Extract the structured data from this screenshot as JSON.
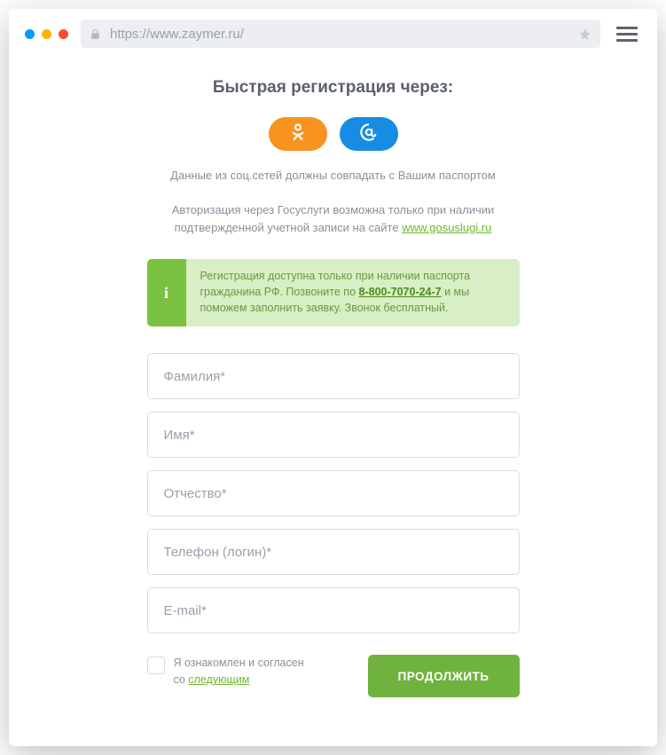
{
  "browser": {
    "url": "https://www.zaymer.ru/"
  },
  "title": "Быстрая регистрация через:",
  "hint": "Данные из соц.сетей должны совпадать с Вашим паспортом",
  "gos": {
    "line1": "Авторизация через Госуслуги возможна только при наличии",
    "line2_prefix": "подтвержденной учетной записи на сайте ",
    "link": "www.gosuslugi.ru"
  },
  "infobox": {
    "t1": "Регистрация доступна только при наличии паспорта",
    "t2a": "гражданина РФ. Позвоните по ",
    "phone": "8-800-7070-24-7",
    "t2b": " и мы",
    "t3": "поможем заполнить заявку. Звонок бесплатный."
  },
  "fields": {
    "lastname": "Фамилия*",
    "firstname": "Имя*",
    "patronymic": "Отчество*",
    "phone": "Телефон (логин)*",
    "email": "E-mail*"
  },
  "consent": {
    "line1": "Я ознакомлен и согласен",
    "line2_prefix": "со ",
    "link": "следующим"
  },
  "submit": "ПРОДОЛЖИТЬ"
}
